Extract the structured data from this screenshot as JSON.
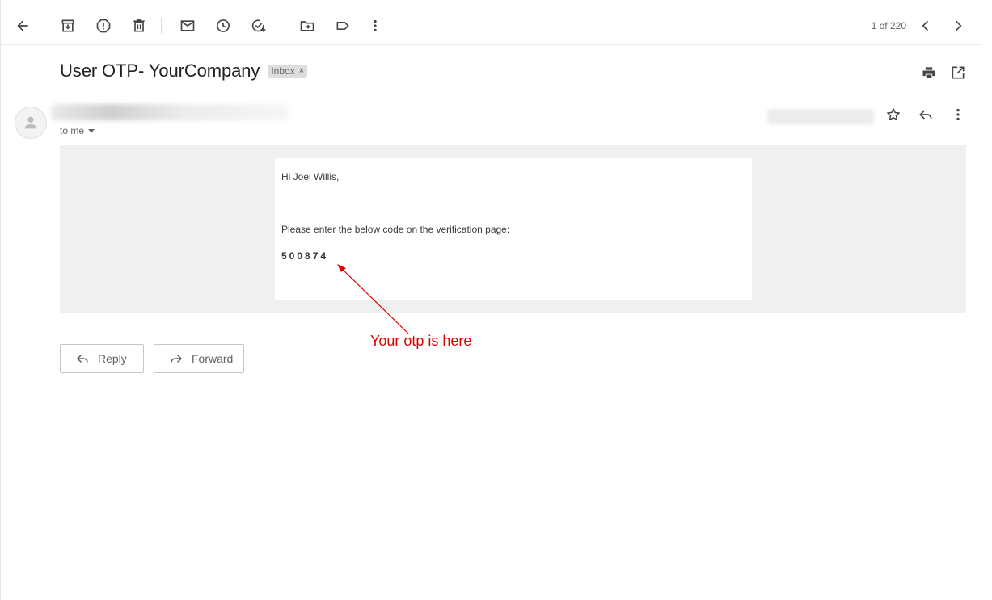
{
  "toolbar": {
    "icons": [
      "back-arrow-icon",
      "archive-icon",
      "report-spam-icon",
      "delete-icon",
      "mark-unread-icon",
      "snooze-icon",
      "add-to-tasks-icon",
      "move-to-icon",
      "label-icon",
      "more-vert-icon"
    ],
    "pager_text": "1 of 220"
  },
  "email": {
    "subject": "User OTP- YourCompany",
    "label_chip": "Inbox",
    "label_remove": "×",
    "to": "to me",
    "greeting": "Hi Joel Willis,",
    "instruction": "Please enter the below code on the verification page:",
    "otp_code": "500874"
  },
  "annotation": {
    "text": "Your otp is here",
    "color": "#e00000"
  },
  "actions": {
    "reply_label": "Reply",
    "forward_label": "Forward"
  },
  "colors": {
    "icon": "#444746",
    "body_background": "#f0f0f0",
    "card_background": "#ffffff"
  }
}
